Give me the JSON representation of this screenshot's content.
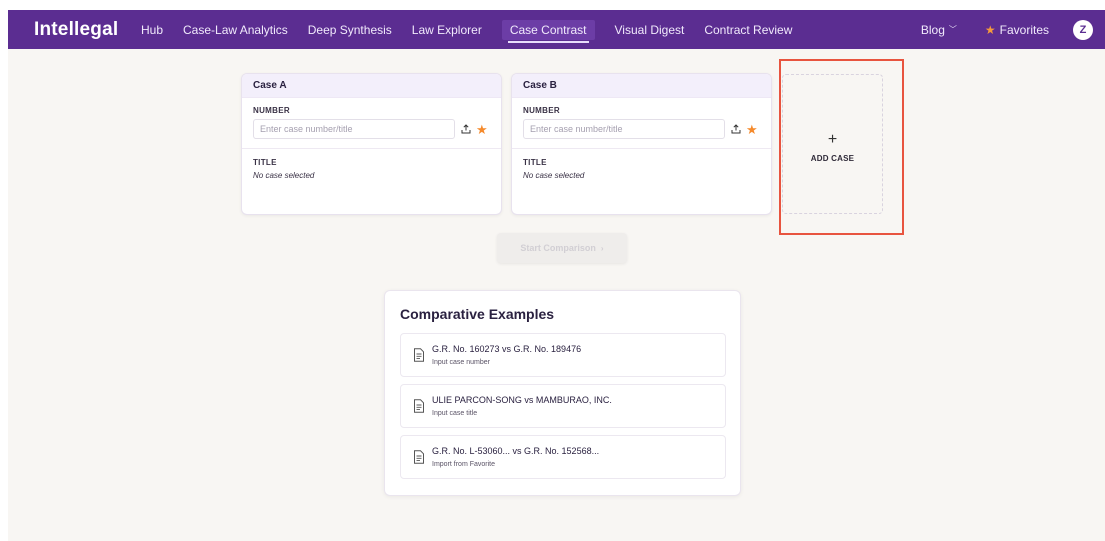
{
  "nav": {
    "brand": "Intellegal",
    "links": [
      "Hub",
      "Case-Law Analytics",
      "Deep Synthesis",
      "Law Explorer",
      "Case Contrast",
      "Visual Digest",
      "Contract Review"
    ],
    "active": "Case Contrast",
    "blog": "Blog",
    "favorites": "Favorites",
    "avatar_initial": "Z"
  },
  "cases": [
    {
      "heading": "Case A",
      "number_label": "NUMBER",
      "number_placeholder": "Enter case number/title",
      "number_value": "",
      "title_label": "TITLE",
      "title_value": "No case selected"
    },
    {
      "heading": "Case B",
      "number_label": "NUMBER",
      "number_placeholder": "Enter case number/title",
      "number_value": "",
      "title_label": "TITLE",
      "title_value": "No case selected"
    }
  ],
  "add_case": {
    "plus": "+",
    "label": "ADD CASE"
  },
  "start_button": {
    "label": "Start Comparison",
    "arrow": "›",
    "enabled": false
  },
  "examples": {
    "title": "Comparative Examples",
    "items": [
      {
        "title": "G.R. No. 160273 vs G.R. No. 189476",
        "subtitle": "Input case number"
      },
      {
        "title": "ULIE PARCON-SONG vs MAMBURAO, INC.",
        "subtitle": "Input case title"
      },
      {
        "title": "G.R. No. L-53060... vs G.R. No. 152568...",
        "subtitle": "Import from Favorite"
      }
    ]
  },
  "colors": {
    "nav_bg": "#5b2d91",
    "star": "#f58a2c",
    "highlight": "#e8543f",
    "page_bg": "#f8f6f3"
  }
}
